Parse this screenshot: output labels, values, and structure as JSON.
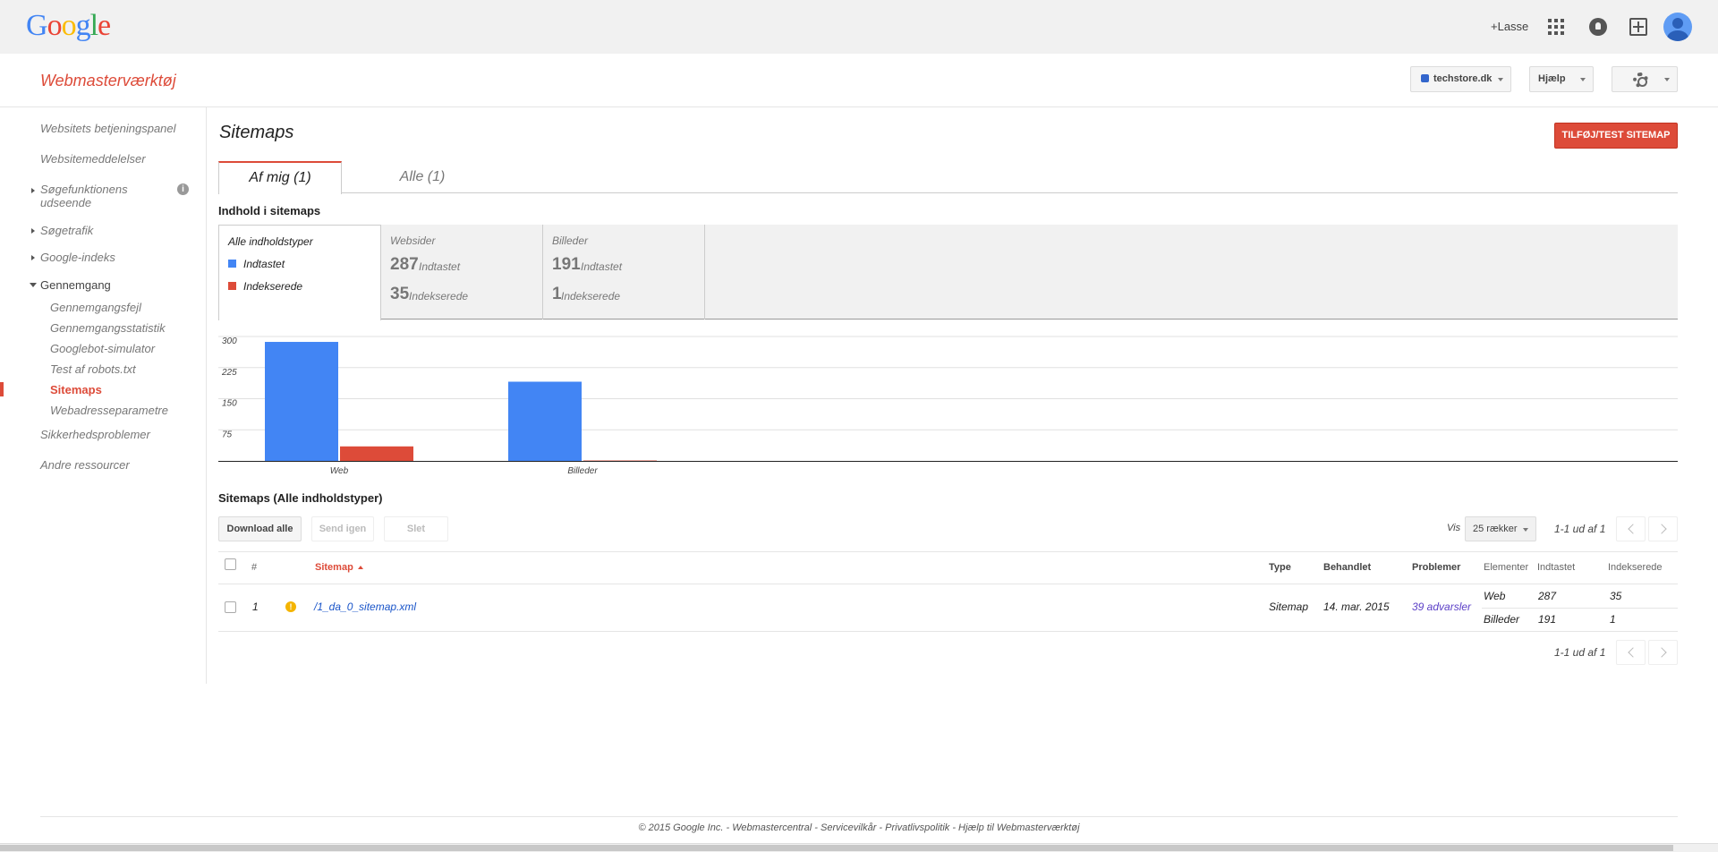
{
  "gbar": {
    "logo_letters": [
      "G",
      "o",
      "o",
      "g",
      "l",
      "e"
    ],
    "user_label": "+Lasse"
  },
  "header": {
    "app_title": "Webmasterværktøj",
    "site_selector": "techstore.dk",
    "help_label": "Hjælp"
  },
  "sidebar": {
    "items": [
      {
        "label": "Websitets betjeningspanel"
      },
      {
        "label": "Websitemeddelelser"
      },
      {
        "label": "Søgefunktionens",
        "label2": "udseende"
      },
      {
        "label": "Søgetrafik"
      },
      {
        "label": "Google-indeks"
      },
      {
        "label": "Gennemgang"
      },
      {
        "label": "Gennemgangsfejl"
      },
      {
        "label": "Gennemgangsstatistik"
      },
      {
        "label": "Googlebot-simulator"
      },
      {
        "label": "Test af robots.txt"
      },
      {
        "label": "Sitemaps"
      },
      {
        "label": "Webadresseparametre"
      },
      {
        "label": "Sikkerhedsproblemer"
      },
      {
        "label": "Andre ressourcer"
      }
    ]
  },
  "main": {
    "title": "Sitemaps",
    "add_button": "TILFØJ/TEST SITEMAP",
    "tabs": [
      {
        "label": "Af mig (1)"
      },
      {
        "label": "Alle (1)"
      }
    ],
    "content_title": "Indhold i sitemaps",
    "summary": {
      "all_label": "Alle indholdstyper",
      "legend": [
        {
          "label": "Indtastet",
          "color": "#4285f4"
        },
        {
          "label": "Indekserede",
          "color": "#dd4b39"
        }
      ],
      "types": [
        {
          "name": "Websider",
          "submitted": "287",
          "submitted_label": "Indtastet",
          "indexed": "35",
          "indexed_label": "Indekserede"
        },
        {
          "name": "Billeder",
          "submitted": "191",
          "submitted_label": "Indtastet",
          "indexed": "1",
          "indexed_label": "Indekserede"
        }
      ]
    },
    "list_title": "Sitemaps (Alle indholdstyper)",
    "toolbar": {
      "download_all": "Download alle",
      "resend": "Send igen",
      "delete": "Slet",
      "show_label": "Vis",
      "rows_select": "25 rækker",
      "pager_text": "1-1 ud af 1"
    },
    "table": {
      "headers": {
        "num": "#",
        "sitemap": "Sitemap",
        "type": "Type",
        "processed": "Behandlet",
        "problems": "Problemer",
        "elements": "Elementer",
        "submitted": "Indtastet",
        "indexed": "Indekserede"
      },
      "rows": [
        {
          "num": "1",
          "path": "/1_da_0_sitemap.xml",
          "type": "Sitemap",
          "processed": "14. mar. 2015",
          "problems": "39 advarsler",
          "elements": [
            {
              "name": "Web",
              "submitted": "287",
              "indexed": "35"
            },
            {
              "name": "Billeder",
              "submitted": "191",
              "indexed": "1"
            }
          ]
        }
      ]
    }
  },
  "chart_data": {
    "type": "bar",
    "categories": [
      "Web",
      "Billeder"
    ],
    "series": [
      {
        "name": "Indtastet",
        "values": [
          287,
          191
        ],
        "color": "#4285f4"
      },
      {
        "name": "Indekserede",
        "values": [
          35,
          1
        ],
        "color": "#dd4b39"
      }
    ],
    "yticks": [
      75,
      150,
      225,
      300
    ],
    "ylim": [
      0,
      300
    ],
    "grid": true,
    "title": "",
    "xlabel": "",
    "ylabel": ""
  },
  "footer": {
    "text": "© 2015 Google Inc. - Webmastercentral - Servicevilkår - Privatlivspolitik - Hjælp til Webmasterværktøj"
  }
}
